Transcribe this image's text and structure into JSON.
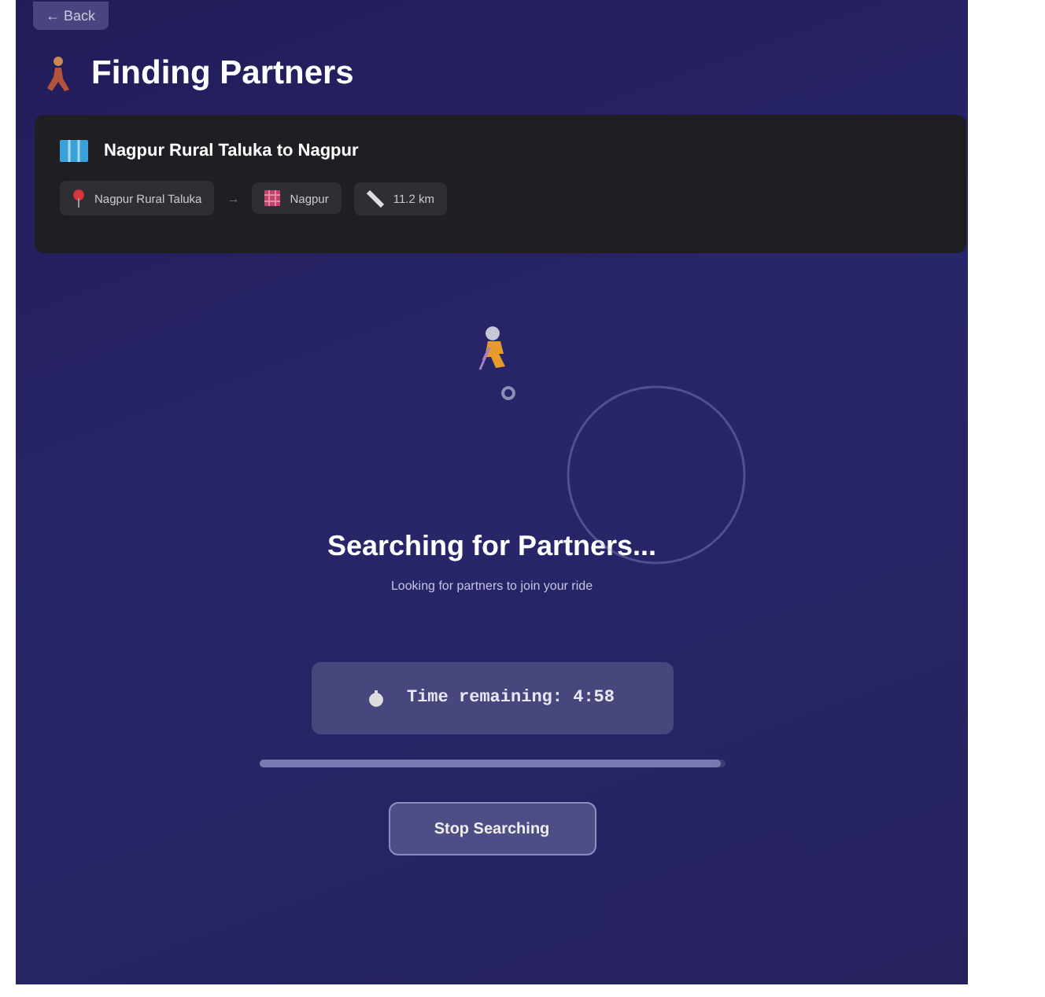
{
  "back_button": {
    "label": "← Back"
  },
  "title": "Finding Partners",
  "route": {
    "title": "Nagpur Rural Taluka to Nagpur",
    "from": "Nagpur Rural Taluka",
    "separator": "→",
    "to": "Nagpur",
    "distance": "11.2 km"
  },
  "status": {
    "heading": "Searching for Partners...",
    "subtitle": "Looking for partners to join your ride"
  },
  "timer": {
    "text": "Time remaining: 4:58"
  },
  "progress": {
    "level": 0.99
  },
  "buttons": [
    {
      "label": "Stop Searching"
    }
  ]
}
